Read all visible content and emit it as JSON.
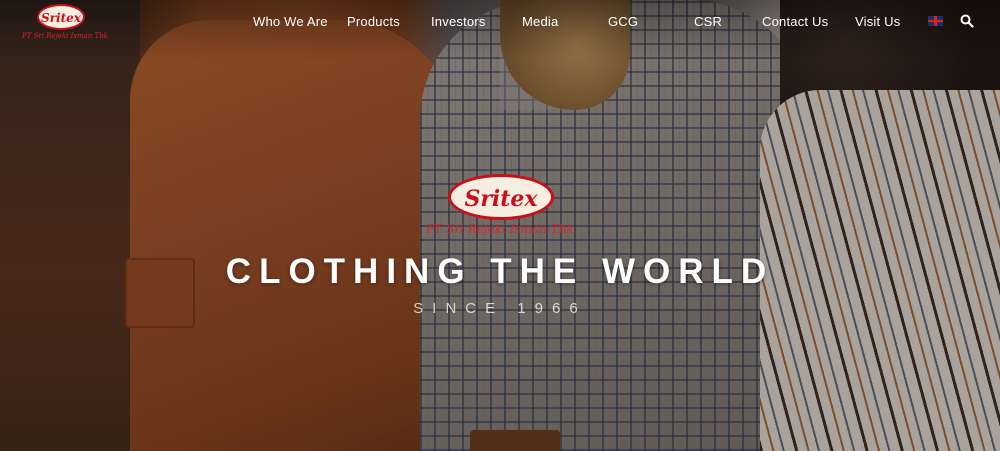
{
  "brand": {
    "logo_text": "Sritex",
    "logo_subtitle": "PT Sri Rejeki Isman Tbk"
  },
  "nav": {
    "items": [
      {
        "label": "Who We Are"
      },
      {
        "label": "Products"
      },
      {
        "label": "Investors"
      },
      {
        "label": "Media"
      },
      {
        "label": "GCG"
      },
      {
        "label": "CSR"
      },
      {
        "label": "Contact Us"
      },
      {
        "label": "Visit Us"
      }
    ],
    "language_icon": "uk-flag-icon",
    "search_icon": "search-icon"
  },
  "hero": {
    "headline": "CLOTHING THE WORLD",
    "tagline": "SINCE 1966"
  },
  "colors": {
    "brand_red": "#c8101a",
    "text": "#ffffff"
  }
}
